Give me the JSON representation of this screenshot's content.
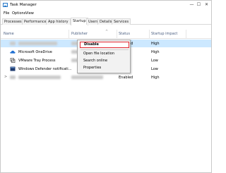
{
  "window": {
    "title": "Task Manager",
    "minimize_glyph": "—",
    "maximize_glyph": "☐",
    "close_glyph": "✕"
  },
  "menu": [
    "File",
    "Options",
    "View"
  ],
  "tabs": [
    {
      "label": "Processes",
      "active": false
    },
    {
      "label": "Performance",
      "active": false
    },
    {
      "label": "App history",
      "active": false
    },
    {
      "label": "Startup",
      "active": true
    },
    {
      "label": "Users",
      "active": false
    },
    {
      "label": "Details",
      "active": false
    },
    {
      "label": "Services",
      "active": false
    }
  ],
  "columns": {
    "name": "Name",
    "publisher": "Publisher",
    "status": "Status",
    "impact": "Startup impact",
    "sort_arrow": "^"
  },
  "rows": [
    {
      "name": "",
      "publisher": "",
      "status": "Enabled",
      "impact": "High",
      "selected": true,
      "icon": "blurred-icon"
    },
    {
      "name": "Microsoft OneDrive",
      "publisher": "",
      "status": "",
      "impact": "High",
      "selected": false,
      "icon": "onedrive-icon"
    },
    {
      "name": "VMware Tray Process",
      "publisher": "",
      "status": "",
      "impact": "Low",
      "selected": false,
      "icon": "vmware-icon"
    },
    {
      "name": "Windows Defender notificati...",
      "publisher": "",
      "status": "",
      "impact": "Low",
      "selected": false,
      "icon": "windows-defender-icon"
    },
    {
      "name": "",
      "publisher": "",
      "status": "Enabled",
      "impact": "High",
      "selected": false,
      "icon": "blurred-icon"
    }
  ],
  "context_menu": {
    "items": [
      "Disable",
      "Open file location",
      "Search online",
      "Properties"
    ],
    "highlighted": "Disable"
  },
  "colors": {
    "selection": "#cce8ff",
    "highlight_border": "#e3262f",
    "header_text": "#4d6082"
  }
}
